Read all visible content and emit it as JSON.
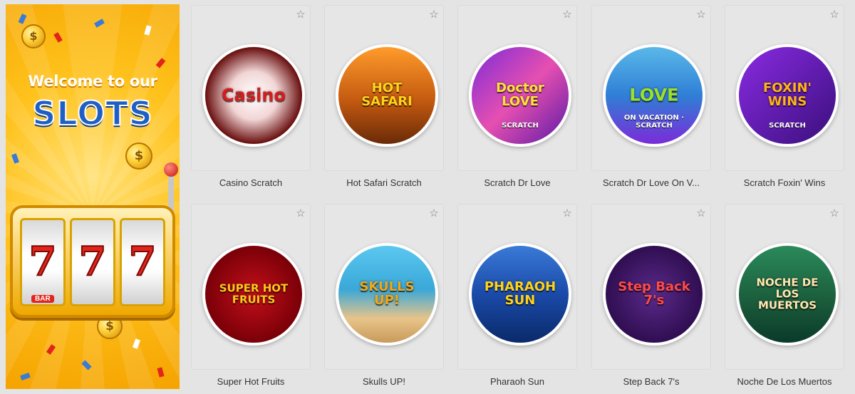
{
  "promo": {
    "welcome": "Welcome to our",
    "slots": "SLOTS",
    "reel_symbol": "7",
    "bar_label": "BAR",
    "coin_symbol": "$",
    "colors": {
      "background": "#ffc21c",
      "slots_text": "#1f5fc4",
      "seven": "#e3241b"
    }
  },
  "favorite_icon": "star-outline-icon",
  "games": [
    {
      "name": "Casino Scratch",
      "logo": "Casino",
      "logo_sub": "",
      "bg": "radial-gradient(circle at 50% 50%,#ffffff 0%,#f2d6d6 35%,#6a1010 70%,#2a0000 100%)",
      "color": "#d81b1b"
    },
    {
      "name": "Hot Safari Scratch",
      "logo": "HOT SAFARI",
      "logo_sub": "",
      "bg": "linear-gradient(#ff9b2b,#c45a10 55%,#6a2a08)",
      "color": "#ffd21a"
    },
    {
      "name": "Scratch Dr Love",
      "logo": "Doctor LOVE",
      "logo_sub": "SCRATCH",
      "bg": "linear-gradient(135deg,#7b2bd8,#e64fb1 50%,#5a1aa6)",
      "color": "#ffe03a"
    },
    {
      "name": "Scratch Dr Love On Vacation",
      "name_display": "Scratch Dr Love On V...",
      "logo": "LOVE",
      "logo_sub": "ON VACATION · SCRATCH",
      "bg": "linear-gradient(#5ab8e8,#2f7fd6 50%,#7b2bd8)",
      "color": "#9be02a"
    },
    {
      "name": "Scratch Foxin' Wins",
      "logo": "FOXIN' WINS",
      "logo_sub": "SCRATCH",
      "bg": "linear-gradient(135deg,#8a2be2,#5a1aa6 60%,#3a0f7a)",
      "color": "#ffb21a"
    },
    {
      "name": "Super Hot Fruits",
      "logo": "SUPER HOT FRUITS",
      "logo_sub": "",
      "bg": "radial-gradient(circle,#c40f1a 0%,#7a0008 70%,#3a0004 100%)",
      "color": "#ffc81a"
    },
    {
      "name": "Skulls UP!",
      "logo": "SKULLS UP!",
      "logo_sub": "",
      "bg": "linear-gradient(#5bc8f0,#3aa8d8 45%,#e8c48a 75%,#c89a5a)",
      "color": "#f0a81a"
    },
    {
      "name": "Pharaoh Sun",
      "logo": "PHARAOH SUN",
      "logo_sub": "",
      "bg": "linear-gradient(#3a7ad8,#1a4aa8 50%,#0a2a6a)",
      "color": "#ffd21a"
    },
    {
      "name": "Step Back 7's",
      "logo": "Step Back 7's",
      "logo_sub": "",
      "bg": "radial-gradient(circle,#5a2a8a 0%,#2a0a4a 80%)",
      "color": "#ff4a4a"
    },
    {
      "name": "Noche De Los Muertos",
      "logo": "NOCHE DE LOS MUERTOS",
      "logo_sub": "",
      "bg": "linear-gradient(#2a8a5a,#1a5a3a 60%,#0a3a2a)",
      "color": "#ffe8b0"
    }
  ]
}
